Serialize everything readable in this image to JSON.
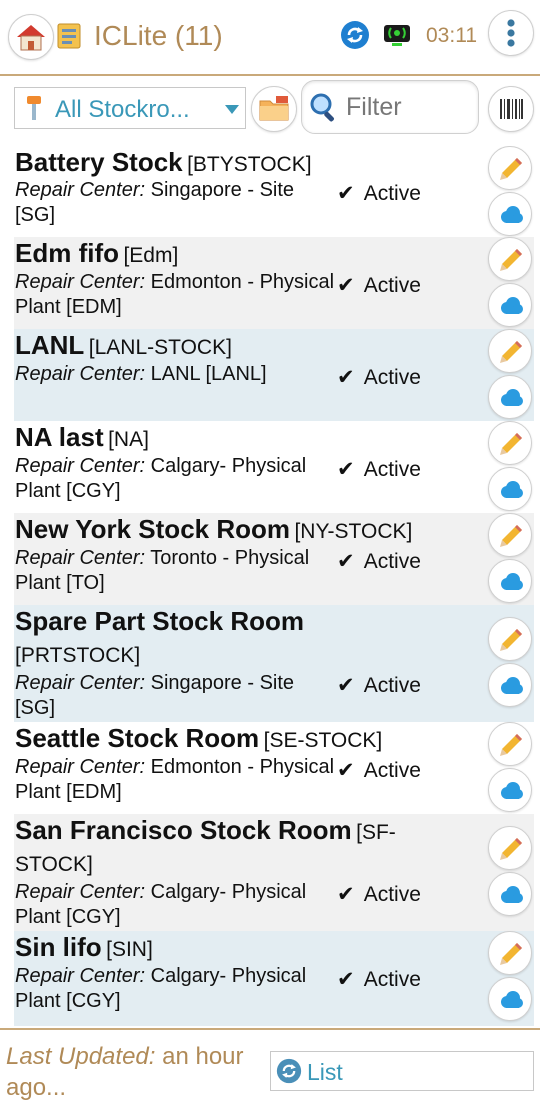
{
  "header": {
    "title": "ICLite (11)",
    "time": "03:11",
    "icons": [
      "home-icon",
      "app-icon",
      "sync-icon",
      "network-icon",
      "more-vertical-icon"
    ]
  },
  "toolbar": {
    "stockroom_select": "All Stockro...",
    "filter_placeholder": "Filter"
  },
  "rows": [
    {
      "name": "Battery Stock",
      "code": "[BTYSTOCK]",
      "rc_label": "Repair Center:",
      "rc_value": "Singapore - Site [SG]",
      "status": "Active"
    },
    {
      "name": "Edm fifo",
      "code": "[Edm]",
      "rc_label": "Repair Center:",
      "rc_value": "Edmonton - Physical Plant [EDM]",
      "status": "Active"
    },
    {
      "name": "LANL",
      "code": "[LANL-STOCK]",
      "rc_label": "Repair Center:",
      "rc_value": "LANL [LANL]",
      "status": "Active"
    },
    {
      "name": "NA last",
      "code": "[NA]",
      "rc_label": "Repair Center:",
      "rc_value": "Calgary- Physical Plant [CGY]",
      "status": "Active"
    },
    {
      "name": "New York Stock Room",
      "code": "[NY-STOCK]",
      "rc_label": "Repair Center:",
      "rc_value": "Toronto - Physical Plant [TO]",
      "status": "Active"
    },
    {
      "name": "Spare Part Stock Room",
      "code": "[PRTSTOCK]",
      "rc_label": "Repair Center:",
      "rc_value": "Singapore - Site [SG]",
      "status": "Active"
    },
    {
      "name": "Seattle Stock Room",
      "code": "[SE-STOCK]",
      "rc_label": "Repair Center:",
      "rc_value": "Edmonton - Physical Plant [EDM]",
      "status": "Active"
    },
    {
      "name": "San Francisco Stock Room",
      "code": "[SF-STOCK]",
      "rc_label": "Repair Center:",
      "rc_value": "Calgary- Physical Plant [CGY]",
      "status": "Active"
    },
    {
      "name": "Sin lifo",
      "code": "[SIN]",
      "rc_label": "Repair Center:",
      "rc_value": "Calgary- Physical Plant [CGY]",
      "status": "Active"
    }
  ],
  "footer": {
    "last_updated_label": "Last Updated:",
    "last_updated_value": "an hour ago...",
    "view_select": "List"
  },
  "colors": {
    "accent_brown": "#b08a57",
    "accent_blue": "#3a98b8",
    "rule": "#c9a97a"
  }
}
